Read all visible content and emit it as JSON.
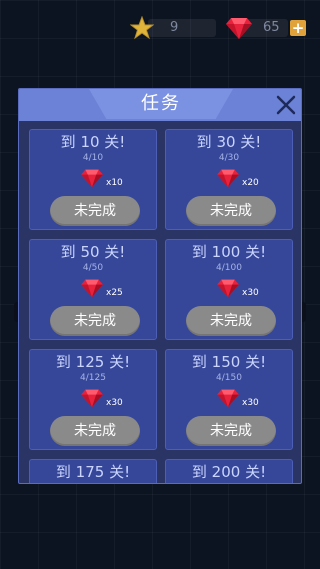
{
  "hud": {
    "stars": "9",
    "gems": "65",
    "plus": "+"
  },
  "modal": {
    "title": "任务",
    "close_icon": "close-icon"
  },
  "tasks": [
    {
      "title": "到 10 关!",
      "progress": "4/10",
      "reward": "x10",
      "status": "未完成"
    },
    {
      "title": "到 30 关!",
      "progress": "4/30",
      "reward": "x20",
      "status": "未完成"
    },
    {
      "title": "到 50 关!",
      "progress": "4/50",
      "reward": "x25",
      "status": "未完成"
    },
    {
      "title": "到 100 关!",
      "progress": "4/100",
      "reward": "x30",
      "status": "未完成"
    },
    {
      "title": "到 125 关!",
      "progress": "4/125",
      "reward": "x30",
      "status": "未完成"
    },
    {
      "title": "到 150 关!",
      "progress": "4/150",
      "reward": "x30",
      "status": "未完成"
    },
    {
      "title": "到 175 关!",
      "progress": "",
      "reward": "",
      "status": ""
    },
    {
      "title": "到 200 关!",
      "progress": "",
      "reward": "",
      "status": ""
    }
  ],
  "colors": {
    "background": "#0d1421",
    "modal": "#2a3566",
    "header": "#6b82d6",
    "card": "#36479a",
    "gem": "#e8223c",
    "star": "#e0b43a",
    "button": "#8a8a8a"
  }
}
